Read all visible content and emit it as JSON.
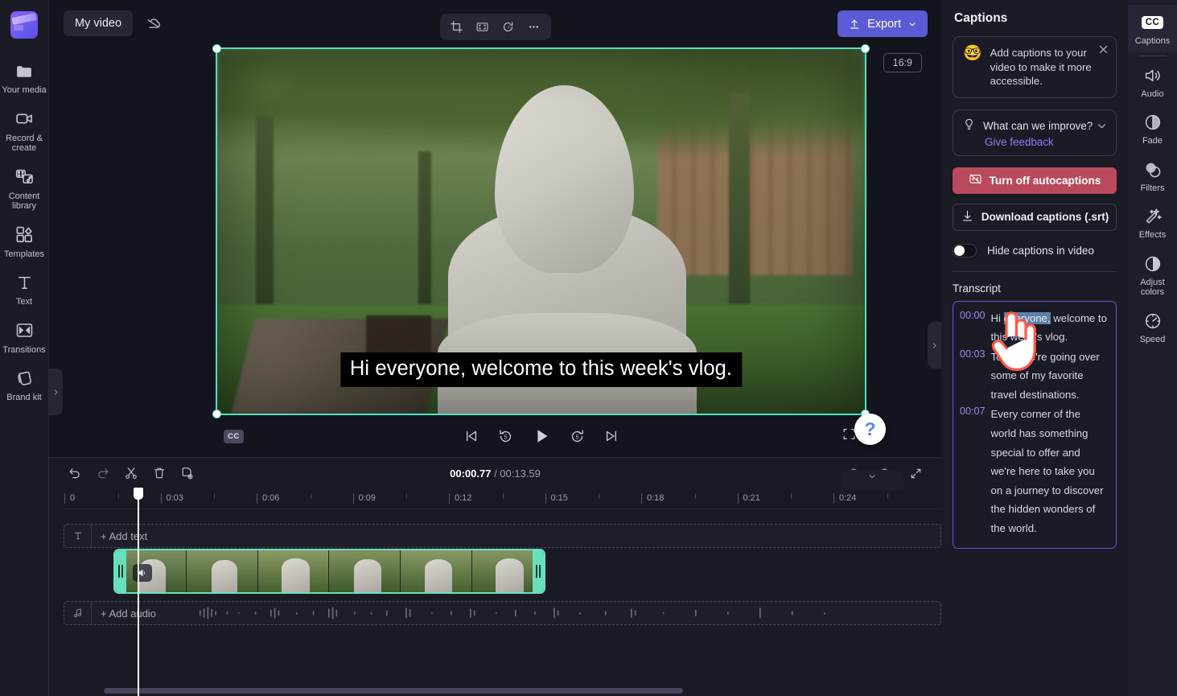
{
  "app": {
    "project_title": "My video",
    "cloud_icon": "cloud-off-icon"
  },
  "left_rail": {
    "logo": "clipchamp-logo",
    "items": [
      {
        "icon": "folder-icon",
        "label": "Your media"
      },
      {
        "icon": "video-camera-icon",
        "label": "Record & create"
      },
      {
        "icon": "library-icon",
        "label": "Content library"
      },
      {
        "icon": "templates-icon",
        "label": "Templates"
      },
      {
        "icon": "text-icon",
        "label": "Text"
      },
      {
        "icon": "transitions-icon",
        "label": "Transitions"
      },
      {
        "icon": "brand-kit-icon",
        "label": "Brand kit"
      }
    ]
  },
  "top_toolbar": {
    "tools": [
      {
        "icon": "crop-icon",
        "name": "crop"
      },
      {
        "icon": "fit-icon",
        "name": "fit-to-frame"
      },
      {
        "icon": "rotate-icon",
        "name": "rotate"
      },
      {
        "icon": "more-icon",
        "name": "more-options"
      }
    ],
    "export_label": "Export"
  },
  "preview": {
    "aspect_ratio": "16:9",
    "caption_overlay": "Hi everyone, welcome to this week's vlog.",
    "cc_label": "CC",
    "transport": [
      {
        "name": "skip-to-start",
        "icon": "skip-back-icon"
      },
      {
        "name": "rewind-5",
        "icon": "rewind-5-icon"
      },
      {
        "name": "play",
        "icon": "play-icon"
      },
      {
        "name": "forward-5",
        "icon": "forward-5-icon"
      },
      {
        "name": "skip-to-end",
        "icon": "skip-forward-icon"
      }
    ],
    "fullscreen_icon": "fullscreen-icon",
    "help_label": "?"
  },
  "timeline": {
    "tools": [
      {
        "icon": "undo-icon",
        "name": "undo"
      },
      {
        "icon": "redo-icon",
        "name": "redo"
      },
      {
        "icon": "split-icon",
        "name": "split"
      },
      {
        "icon": "delete-icon",
        "name": "delete"
      },
      {
        "icon": "duplicate-icon",
        "name": "duplicate"
      }
    ],
    "current_time": "00:00.77",
    "total_time": "/ 00:13.59",
    "zoom_tools": [
      {
        "icon": "zoom-out-icon",
        "name": "zoom-out"
      },
      {
        "icon": "zoom-in-icon",
        "name": "zoom-in"
      },
      {
        "icon": "fit-timeline-icon",
        "name": "fit-to-timeline"
      }
    ],
    "ruler_labels": [
      "0",
      "0:03",
      "0:06",
      "0:09",
      "0:12",
      "0:15",
      "0:18",
      "0:21",
      "0:24"
    ],
    "text_track_label": "+ Add text",
    "audio_track_label": "+ Add audio",
    "video_clip_name": "selected-video-clip"
  },
  "captions_panel": {
    "title": "Captions",
    "promo": {
      "emoji": "nerd-face-emoji",
      "text": "Add captions to your video to make it more accessible.",
      "close_icon": "close-icon"
    },
    "feedback": {
      "question": "What can we improve?",
      "link": "Give feedback",
      "bulb_icon": "lightbulb-icon",
      "chevron_icon": "chevron-down-icon"
    },
    "turn_off_label": "Turn off autocaptions",
    "turn_off_icon": "captions-off-icon",
    "download_label": "Download captions (.srt)",
    "download_icon": "download-icon",
    "hide_captions_label": "Hide captions in video",
    "hide_captions_on": false,
    "transcript_heading": "Transcript",
    "transcript": [
      {
        "time": "00:00",
        "pre": "Hi ",
        "selected": "everyone,",
        "post": " welcome to this week's vlog."
      },
      {
        "time": "00:03",
        "pre": "",
        "selected": "",
        "post": "Today we're going over some of my favorite travel destinations."
      },
      {
        "time": "00:07",
        "pre": "",
        "selected": "",
        "post": "Every corner of the world has something special to offer and we're here to take you on a journey to discover the hidden wonders of the world."
      }
    ]
  },
  "right_rail": {
    "items": [
      {
        "icon": "cc-icon",
        "label": "Captions",
        "active": true
      },
      {
        "icon": "audio-icon",
        "label": "Audio",
        "active": false
      },
      {
        "icon": "fade-icon",
        "label": "Fade",
        "active": false
      },
      {
        "icon": "filters-icon",
        "label": "Filters",
        "active": false
      },
      {
        "icon": "effects-icon",
        "label": "Effects",
        "active": false
      },
      {
        "icon": "adjust-colors-icon",
        "label": "Adjust colors",
        "active": false
      },
      {
        "icon": "speed-icon",
        "label": "Speed",
        "active": false
      }
    ]
  },
  "colors": {
    "accent_purple": "#5b5bd6",
    "danger_red": "#b94a5c",
    "clip_teal": "#67e0bd",
    "link_purple": "#8f7bf5",
    "panel_bg": "#1b1b26"
  }
}
